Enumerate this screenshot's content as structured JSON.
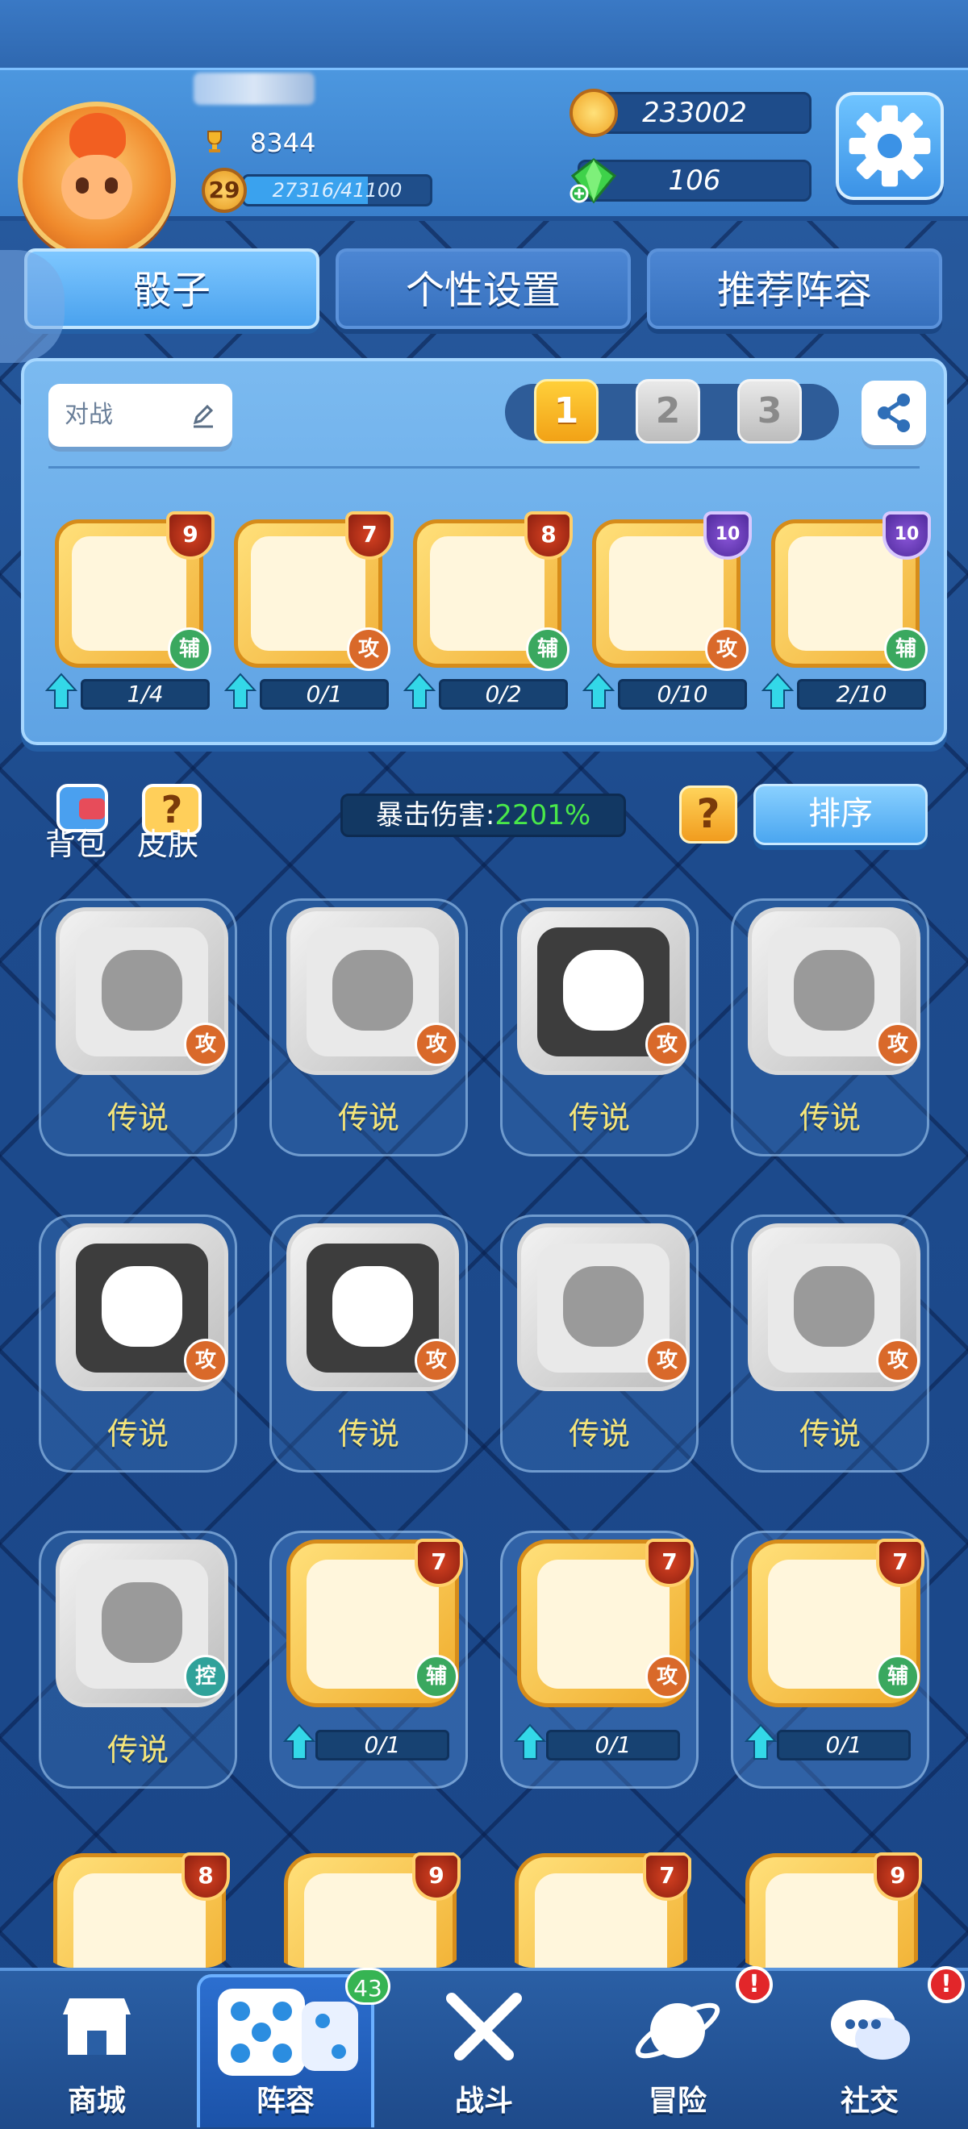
{
  "header": {
    "trophies": "8344",
    "level": "29",
    "xp_text": "27316/41100",
    "xp_fraction": 0.664,
    "coins": "233002",
    "gems": "106"
  },
  "tabs": [
    "骰子",
    "个性设置",
    "推荐阵容"
  ],
  "deck": {
    "mode": "对战",
    "deck_numbers": [
      "1",
      "2",
      "3"
    ],
    "active_deck": 1,
    "cards": [
      {
        "level": "9",
        "type": "辅",
        "progress": "1/4",
        "icon": "firework-icon",
        "shield": "red"
      },
      {
        "level": "7",
        "type": "攻",
        "progress": "0/1",
        "icon": "snowman-icon",
        "shield": "red"
      },
      {
        "level": "8",
        "type": "辅",
        "progress": "0/2",
        "icon": "sakura-icon",
        "shield": "red"
      },
      {
        "level": "10",
        "type": "攻",
        "progress": "0/10",
        "icon": "shuriken-icon",
        "shield": "purple"
      },
      {
        "level": "10",
        "type": "辅",
        "progress": "2/10",
        "icon": "mask-icon",
        "shield": "purple"
      }
    ]
  },
  "controls": {
    "bag_label": "背包",
    "skin_label": "皮肤",
    "crit_label": "暴击伤害:",
    "crit_value": "2201%",
    "help_label": "?",
    "sort_label": "排序"
  },
  "collection": [
    {
      "label": "传说",
      "type": "攻",
      "icon": "robot-icon",
      "owned": false,
      "dark": false
    },
    {
      "label": "传说",
      "type": "攻",
      "icon": "shark-icon",
      "owned": false,
      "dark": false
    },
    {
      "label": "传说",
      "type": "攻",
      "icon": "cow-icon",
      "owned": false,
      "dark": true
    },
    {
      "label": "传说",
      "type": "攻",
      "icon": "rabbit-icon",
      "owned": false,
      "dark": false
    },
    {
      "label": "传说",
      "type": "攻",
      "icon": "dragon-icon",
      "owned": false,
      "dark": true
    },
    {
      "label": "传说",
      "type": "攻",
      "icon": "lion-icon",
      "owned": false,
      "dark": true
    },
    {
      "label": "传说",
      "type": "攻",
      "icon": "devil-icon",
      "owned": false,
      "dark": false
    },
    {
      "label": "传说",
      "type": "攻",
      "icon": "gem-shard-icon",
      "owned": false,
      "dark": false
    },
    {
      "label": "传说",
      "type": "控",
      "icon": "angel-wings-icon",
      "owned": false,
      "dark": false
    },
    {
      "level": "7",
      "type": "辅",
      "progress": "0/1",
      "icon": "fire-dragon-icon",
      "owned": true
    },
    {
      "level": "7",
      "type": "攻",
      "progress": "0/1",
      "icon": "snowman-icon",
      "owned": true
    },
    {
      "level": "7",
      "type": "辅",
      "progress": "0/1",
      "icon": "coin-stack-icon",
      "owned": true
    },
    {
      "level": "8",
      "icon": "phoenix-icon",
      "owned": true,
      "partial": true
    },
    {
      "level": "9",
      "icon": "twins-icon",
      "owned": true,
      "partial": true
    },
    {
      "level": "7",
      "icon": "ram-icon",
      "owned": true,
      "partial": true
    },
    {
      "level": "9",
      "icon": "libra-icon",
      "owned": true,
      "partial": true
    }
  ],
  "nav": {
    "items": [
      "商城",
      "阵容",
      "战斗",
      "冒险",
      "社交"
    ],
    "lineup_count": "43",
    "alert_symbol": "!"
  }
}
